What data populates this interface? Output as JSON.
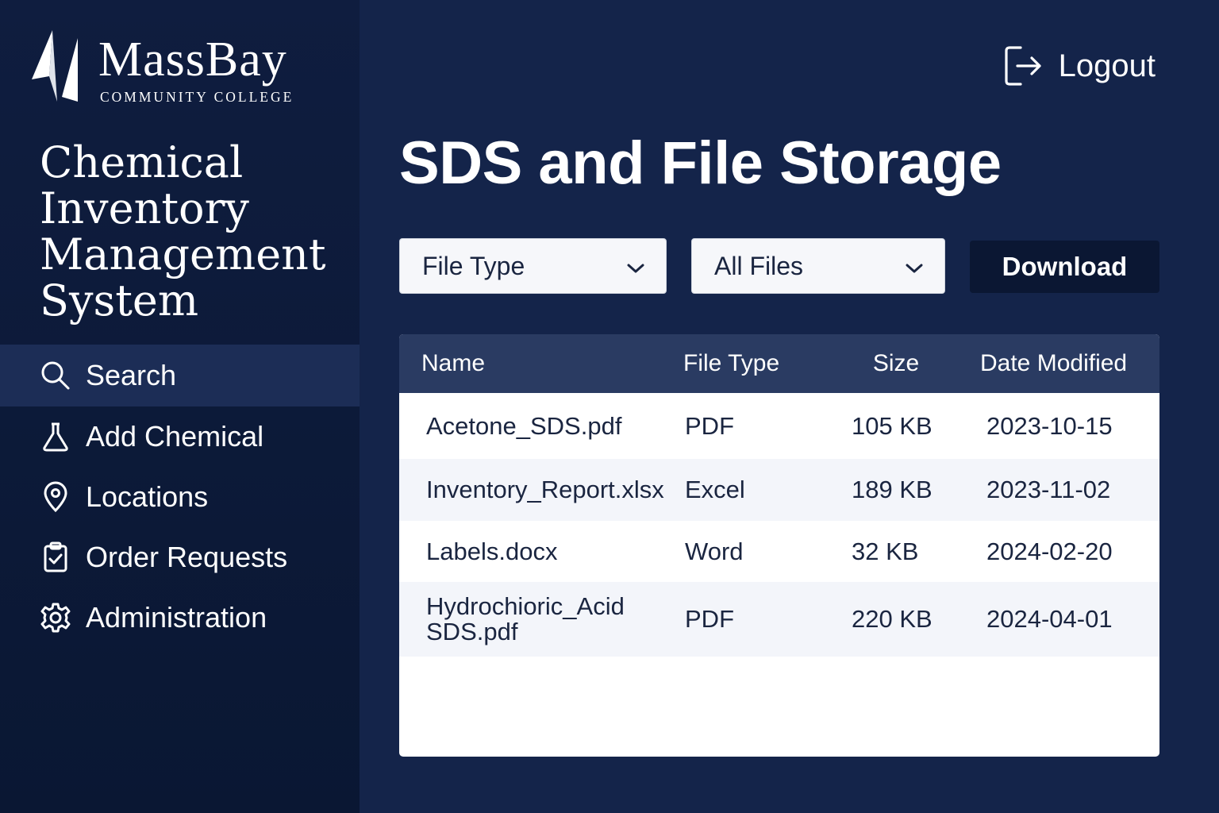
{
  "brand": {
    "name": "MassBay",
    "subtitle": "COMMUNITY COLLEGE",
    "app_title": "Chemical Inventory Management System"
  },
  "sidebar": {
    "items": [
      {
        "label": "Search",
        "icon": "search-icon",
        "active": true
      },
      {
        "label": "Add Chemical",
        "icon": "flask-icon",
        "active": false
      },
      {
        "label": "Locations",
        "icon": "map-pin-icon",
        "active": false
      },
      {
        "label": "Order Requests",
        "icon": "clipboard-check-icon",
        "active": false
      },
      {
        "label": "Administration",
        "icon": "gear-icon",
        "active": false
      }
    ]
  },
  "header": {
    "logout_label": "Logout",
    "page_title": "SDS and File Storage"
  },
  "toolbar": {
    "file_type_select": "File Type",
    "files_select": "All Files",
    "download_label": "Download"
  },
  "table": {
    "columns": [
      "Name",
      "File Type",
      "Size",
      "Date Modified"
    ],
    "rows": [
      {
        "name": "Acetone_SDS.pdf",
        "type": "PDF",
        "size": "105 KB",
        "date": "2023-10-15"
      },
      {
        "name": "Inventory_Report.xlsx",
        "type": "Excel",
        "size": "189 KB",
        "date": "2023-11-02"
      },
      {
        "name": "Labels.docx",
        "type": "Word",
        "size": "32 KB",
        "date": "2024-02-20"
      },
      {
        "name": "Hydrochioric_Acid SDS.pdf",
        "type": "PDF",
        "size": "220 KB",
        "date": "2024-04-01"
      }
    ]
  },
  "colors": {
    "sidebar_bg": "#0f1d3f",
    "main_bg": "#14244a",
    "table_header_bg": "#2a3b62",
    "button_bg": "#0b1733",
    "row_alt_bg": "#f3f5fa"
  }
}
